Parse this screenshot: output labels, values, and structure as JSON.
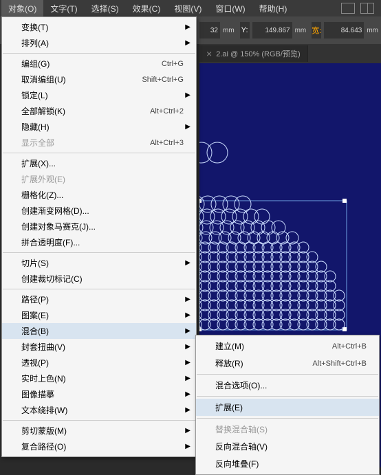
{
  "menubar": {
    "items": [
      "对象(O)",
      "文字(T)",
      "选择(S)",
      "效果(C)",
      "视图(V)",
      "窗口(W)",
      "帮助(H)"
    ],
    "activeIndex": 0
  },
  "controlbar": {
    "partial_value": "32",
    "y_label": "Y:",
    "y_value": "149.867",
    "w_label": "宽:",
    "w_value": "84.643",
    "unit": "mm"
  },
  "tabs": {
    "doc_name": "2.ai @ 150% (RGB/预览)",
    "close": "×"
  },
  "menu": [
    {
      "type": "item",
      "label": "变换(T)",
      "sub": true
    },
    {
      "type": "item",
      "label": "排列(A)",
      "sub": true
    },
    {
      "type": "sep"
    },
    {
      "type": "item",
      "label": "编组(G)",
      "shortcut": "Ctrl+G"
    },
    {
      "type": "item",
      "label": "取消编组(U)",
      "shortcut": "Shift+Ctrl+G"
    },
    {
      "type": "item",
      "label": "锁定(L)",
      "sub": true
    },
    {
      "type": "item",
      "label": "全部解锁(K)",
      "shortcut": "Alt+Ctrl+2"
    },
    {
      "type": "item",
      "label": "隐藏(H)",
      "sub": true
    },
    {
      "type": "item",
      "label": "显示全部",
      "shortcut": "Alt+Ctrl+3",
      "disabled": true
    },
    {
      "type": "sep"
    },
    {
      "type": "item",
      "label": "扩展(X)..."
    },
    {
      "type": "item",
      "label": "扩展外观(E)",
      "disabled": true
    },
    {
      "type": "item",
      "label": "栅格化(Z)..."
    },
    {
      "type": "item",
      "label": "创建渐变网格(D)..."
    },
    {
      "type": "item",
      "label": "创建对象马赛克(J)..."
    },
    {
      "type": "item",
      "label": "拼合透明度(F)..."
    },
    {
      "type": "sep"
    },
    {
      "type": "item",
      "label": "切片(S)",
      "sub": true
    },
    {
      "type": "item",
      "label": "创建裁切标记(C)"
    },
    {
      "type": "sep"
    },
    {
      "type": "item",
      "label": "路径(P)",
      "sub": true
    },
    {
      "type": "item",
      "label": "图案(E)",
      "sub": true
    },
    {
      "type": "item",
      "label": "混合(B)",
      "sub": true,
      "highlighted": true
    },
    {
      "type": "item",
      "label": "封套扭曲(V)",
      "sub": true
    },
    {
      "type": "item",
      "label": "透视(P)",
      "sub": true
    },
    {
      "type": "item",
      "label": "实时上色(N)",
      "sub": true
    },
    {
      "type": "item",
      "label": "图像描摹",
      "sub": true
    },
    {
      "type": "item",
      "label": "文本绕排(W)",
      "sub": true
    },
    {
      "type": "sep"
    },
    {
      "type": "item",
      "label": "剪切蒙版(M)",
      "sub": true
    },
    {
      "type": "item",
      "label": "复合路径(O)",
      "sub": true
    }
  ],
  "submenu": [
    {
      "type": "item",
      "label": "建立(M)",
      "shortcut": "Alt+Ctrl+B"
    },
    {
      "type": "item",
      "label": "释放(R)",
      "shortcut": "Alt+Shift+Ctrl+B"
    },
    {
      "type": "sep"
    },
    {
      "type": "item",
      "label": "混合选项(O)..."
    },
    {
      "type": "sep"
    },
    {
      "type": "item",
      "label": "扩展(E)",
      "highlighted": true
    },
    {
      "type": "sep"
    },
    {
      "type": "item",
      "label": "替换混合轴(S)",
      "disabled": true
    },
    {
      "type": "item",
      "label": "反向混合轴(V)"
    },
    {
      "type": "item",
      "label": "反向堆叠(F)"
    }
  ]
}
